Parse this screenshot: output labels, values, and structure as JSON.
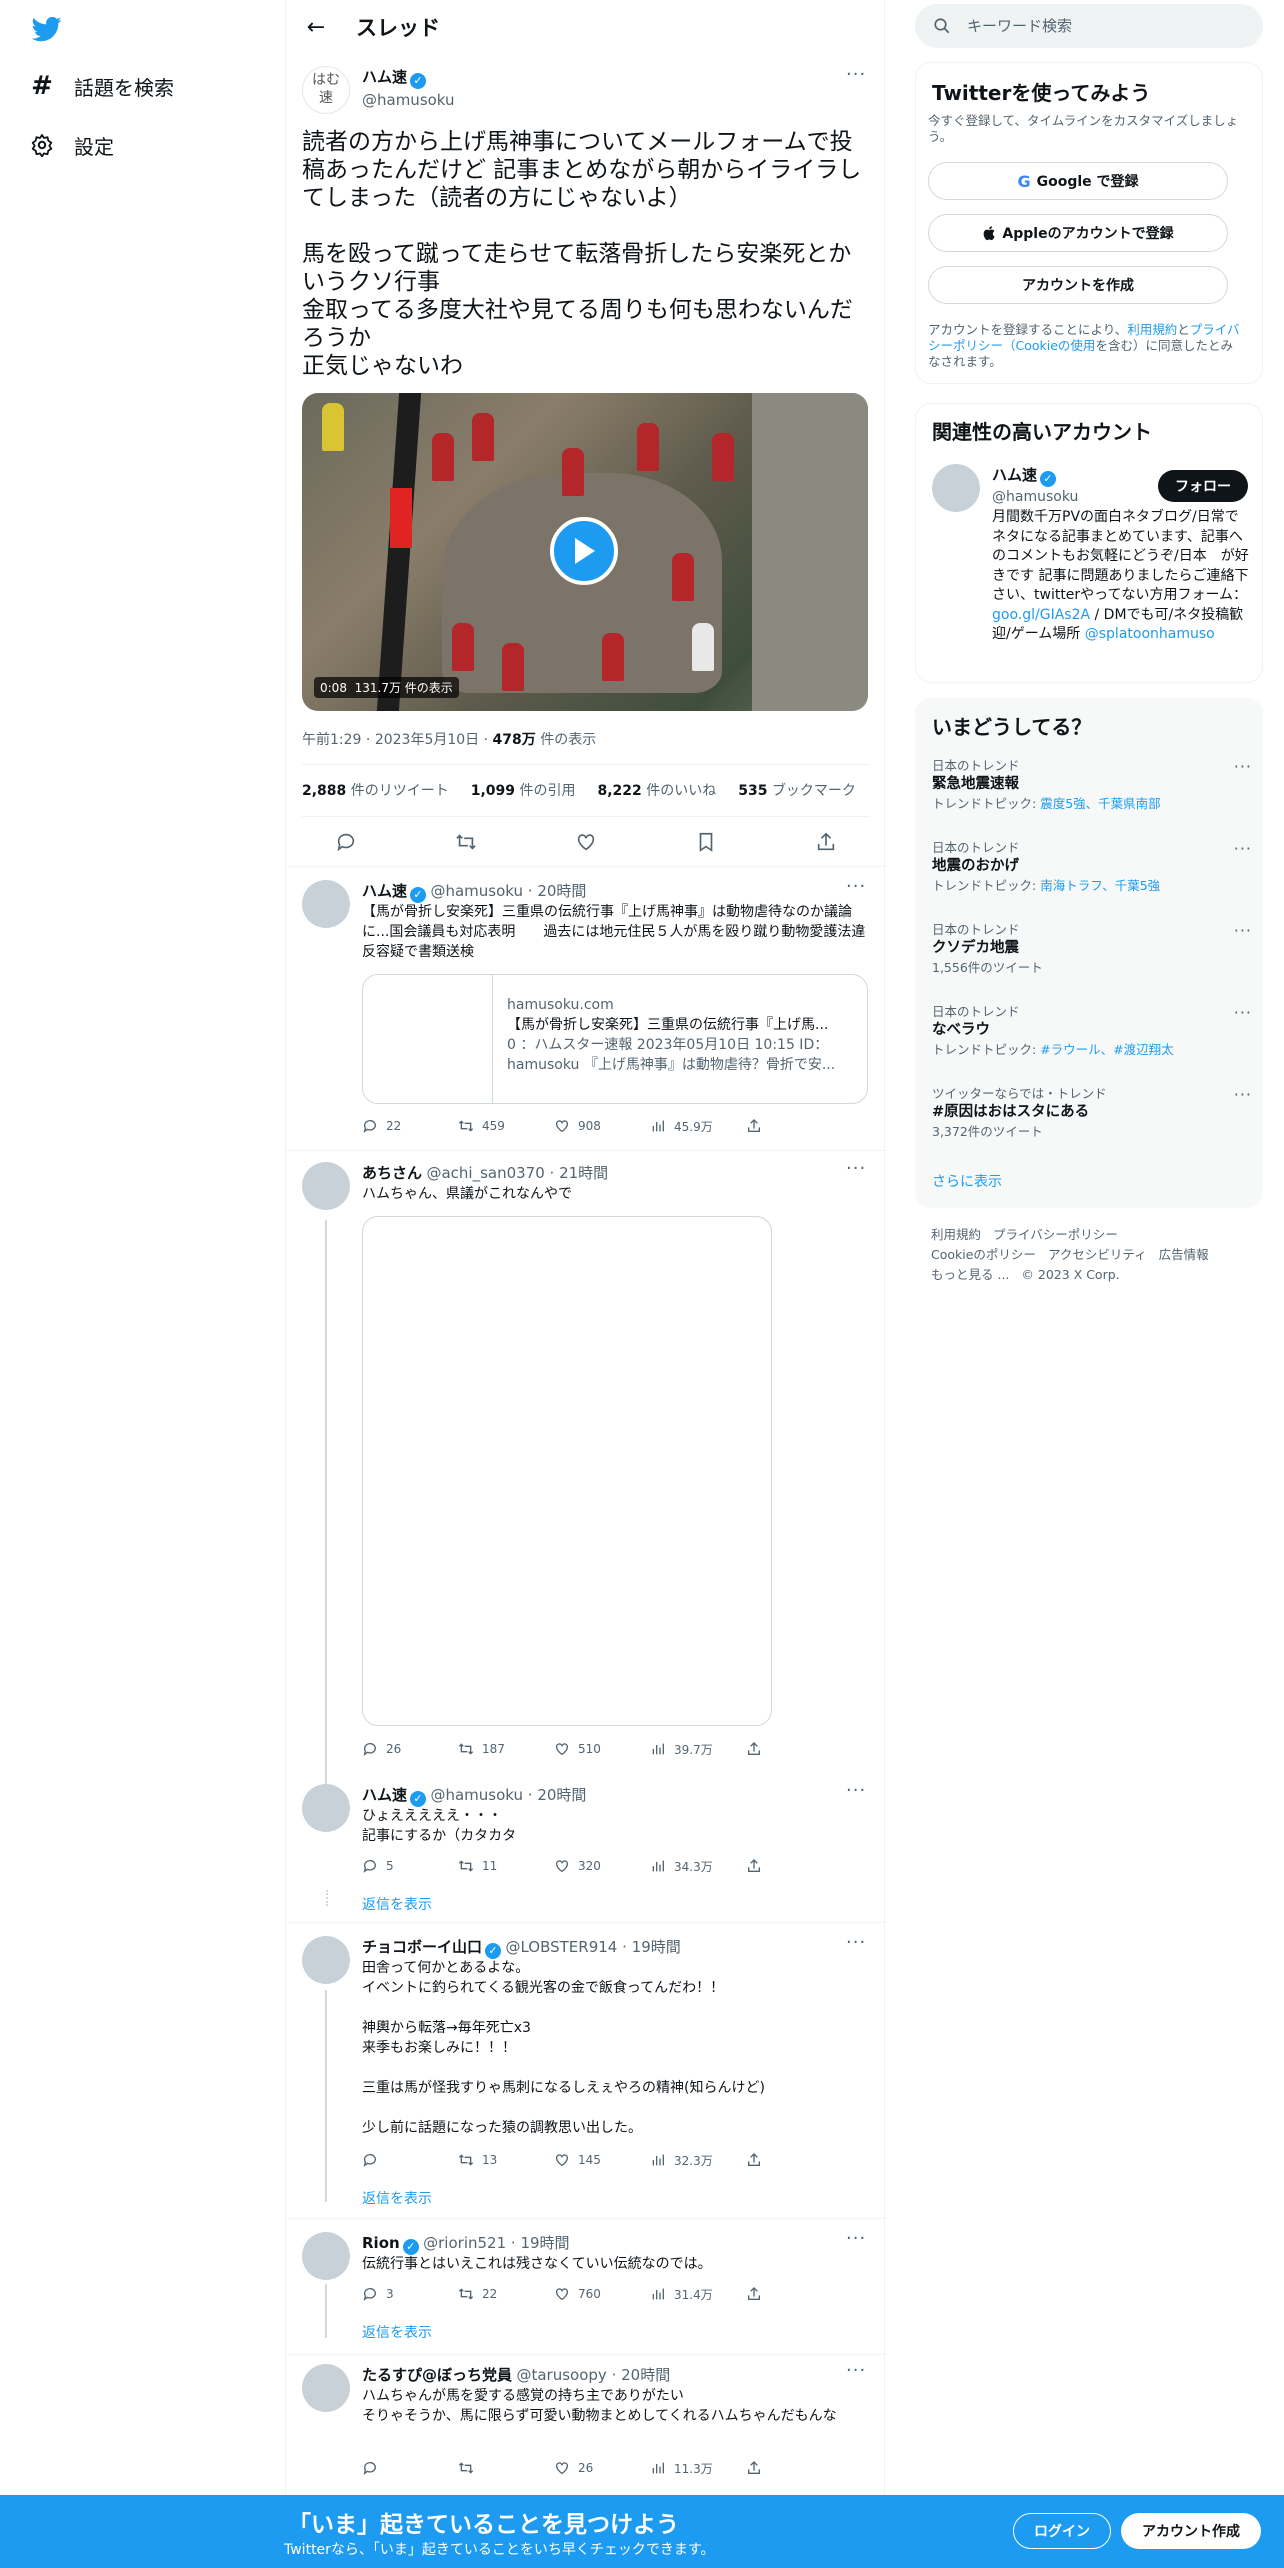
{
  "nav": {
    "items": [
      {
        "label": "話題を検索",
        "icon": "hashtag-icon"
      },
      {
        "label": "設定",
        "icon": "gear-icon"
      }
    ]
  },
  "header": {
    "title": "スレッド"
  },
  "main_tweet": {
    "avatar_text": "はむ速",
    "name": "ハム速",
    "handle": "@hamusoku",
    "text": "読者の方から上げ馬神事についてメールフォームで投稿あったんだけど 記事まとめながら朝からイライラしてしまった（読者の方にじゃないよ）\n\n馬を殴って蹴って走らせて転落骨折したら安楽死とかいうクソ行事\n金取ってる多度大社や見てる周りも何も思わないんだろうか\n正気じゃないわ",
    "video_time": "0:08",
    "video_views": "131.7万 件の表示",
    "time": "午前1:29",
    "date": "2023年5月10日",
    "views_count": "478万",
    "views_label": "件の表示",
    "stats": [
      {
        "count": "2,888",
        "label": "件のリツイート"
      },
      {
        "count": "1,099",
        "label": "件の引用"
      },
      {
        "count": "8,222",
        "label": "件のいいね"
      },
      {
        "count": "535",
        "label": "ブックマーク"
      }
    ]
  },
  "replies": [
    {
      "name": "ハム速",
      "handle": "@hamusoku",
      "time": "20時間",
      "text": "【馬が骨折し安楽死】三重県の伝統行事『上げ馬神事』は動物虐待なのか議論に...国会議員も対応表明　　過去には地元住民５人が馬を殴り蹴り動物愛護法違反容疑で書類送検",
      "card": {
        "domain": "hamusoku.com",
        "title": "【馬が骨折し安楽死】三重県の伝統行事『上げ馬...",
        "desc1": "0 ：ハムスター速報 2023年05月10日 10:15 ID：",
        "desc2": "hamusoku 『上げ馬神事』は動物虐待？骨折で安..."
      },
      "counts": {
        "reply": "22",
        "retweet": "459",
        "like": "908",
        "views": "45.9万"
      }
    },
    {
      "name": "あちさん",
      "handle": "@achi_san0370",
      "time": "21時間",
      "text": "ハムちゃん、県議がこれなんやで",
      "counts": {
        "reply": "26",
        "retweet": "187",
        "like": "510",
        "views": "39.7万"
      }
    },
    {
      "name": "ハム速",
      "handle": "@hamusoku",
      "time": "20時間",
      "text": "ひょえええええ・・・\n記事にするか（カタカタ",
      "counts": {
        "reply": "5",
        "retweet": "11",
        "like": "320",
        "views": "34.3万"
      },
      "show_replies": "返信を表示"
    },
    {
      "name": "チョコボーイ山口",
      "handle": "@LOBSTER914",
      "time": "19時間",
      "text": "田舎って何かとあるよな。\nイベントに釣られてくる観光客の金で飯食ってんだわ！！\n\n神輿から転落→毎年死亡x3\n来季もお楽しみに！！！\n\n三重は馬が怪我すりゃ馬刺になるしえぇやろの精神(知らんけど)\n\n少し前に話題になった猿の調教思い出した。",
      "counts": {
        "reply": "",
        "retweet": "13",
        "like": "145",
        "views": "32.3万"
      },
      "show_replies": "返信を表示"
    },
    {
      "name": "Rion",
      "handle": "@riorin521",
      "time": "19時間",
      "text": "伝統行事とはいえこれは残さなくていい伝統なのでは。",
      "counts": {
        "reply": "3",
        "retweet": "22",
        "like": "760",
        "views": "31.4万"
      },
      "show_replies": "返信を表示"
    },
    {
      "name": "たるすぴ@ぼっち党員",
      "handle": "@tarusoopy",
      "time": "20時間",
      "text": "ハムちゃんが馬を愛する感覚の持ち主でありがたい\nそりゃそうか、馬に限らず可愛い動物まとめしてくれるハムちゃんだもんな",
      "counts": {
        "reply": "",
        "retweet": "",
        "like": "26",
        "views": "11.3万"
      }
    }
  ],
  "sidebar": {
    "search_placeholder": "キーワード検索",
    "signup": {
      "title": "Twitterを使ってみよう",
      "subtitle": "今すぐ登録して、タイムラインをカスタマイズしましょう。",
      "google": "Google で登録",
      "apple": "Appleのアカウントで登録",
      "create": "アカウントを作成",
      "terms_1": "アカウントを登録することにより、",
      "terms_link1": "利用規約",
      "terms_2": "と",
      "terms_link2": "プライバシーポリシー（Cookieの使用",
      "terms_3": "を含む）に同意したとみなされます。"
    },
    "related": {
      "title": "関連性の高いアカウント",
      "name": "ハム速",
      "handle": "@hamusoku",
      "follow": "フォロー",
      "bio_1": "月間数千万PVの面白ネタブログ/日常でネタになる記事まとめています、記事へのコメントもお気軽にどうぞ/日本　が好きです 記事に問題ありましたらご連絡下さい、twitterやってない方用フォーム：",
      "bio_link": "goo.gl/GIAs2A",
      "bio_2": " / DMでも可/ネタ投稿歓迎/ゲーム場所 ",
      "bio_link2": "@splatoonhamuso"
    },
    "trends": {
      "title": "いまどうしてる？",
      "items": [
        {
          "context": "日本のトレンド",
          "name": "緊急地震速報",
          "sub_prefix": "トレンドトピック: ",
          "sub_links": "震度5強、千葉県南部"
        },
        {
          "context": "日本のトレンド",
          "name": "地震のおかげ",
          "sub_prefix": "トレンドトピック: ",
          "sub_links": "南海トラフ、千葉5強"
        },
        {
          "context": "日本のトレンド",
          "name": "クソデカ地震",
          "sub_prefix": "1,556件のツイート",
          "sub_links": ""
        },
        {
          "context": "日本のトレンド",
          "name": "なべラウ",
          "sub_prefix": "トレンドトピック: ",
          "sub_links": "#ラウール、#渡辺翔太"
        },
        {
          "context": "ツイッターならでは・トレンド",
          "name": "#原因はおはスタにある",
          "sub_prefix": "3,372件のツイート",
          "sub_links": ""
        }
      ],
      "show_more": "さらに表示"
    },
    "footer": {
      "links": [
        "利用規約",
        "プライバシーポリシー",
        "Cookieのポリシー",
        "アクセシビリティ",
        "広告情報",
        "もっと見る ..."
      ],
      "copyright": "© 2023 X Corp."
    }
  },
  "bottombar": {
    "title": "「いま」起きていることを見つけよう",
    "subtitle": "Twitterなら、「いま」起きていることをいち早くチェックできます。",
    "login": "ログイン",
    "signup": "アカウント作成"
  },
  "colors": {
    "accent": "#1d9bf0",
    "text": "#0f1419",
    "secondary": "#536471"
  }
}
